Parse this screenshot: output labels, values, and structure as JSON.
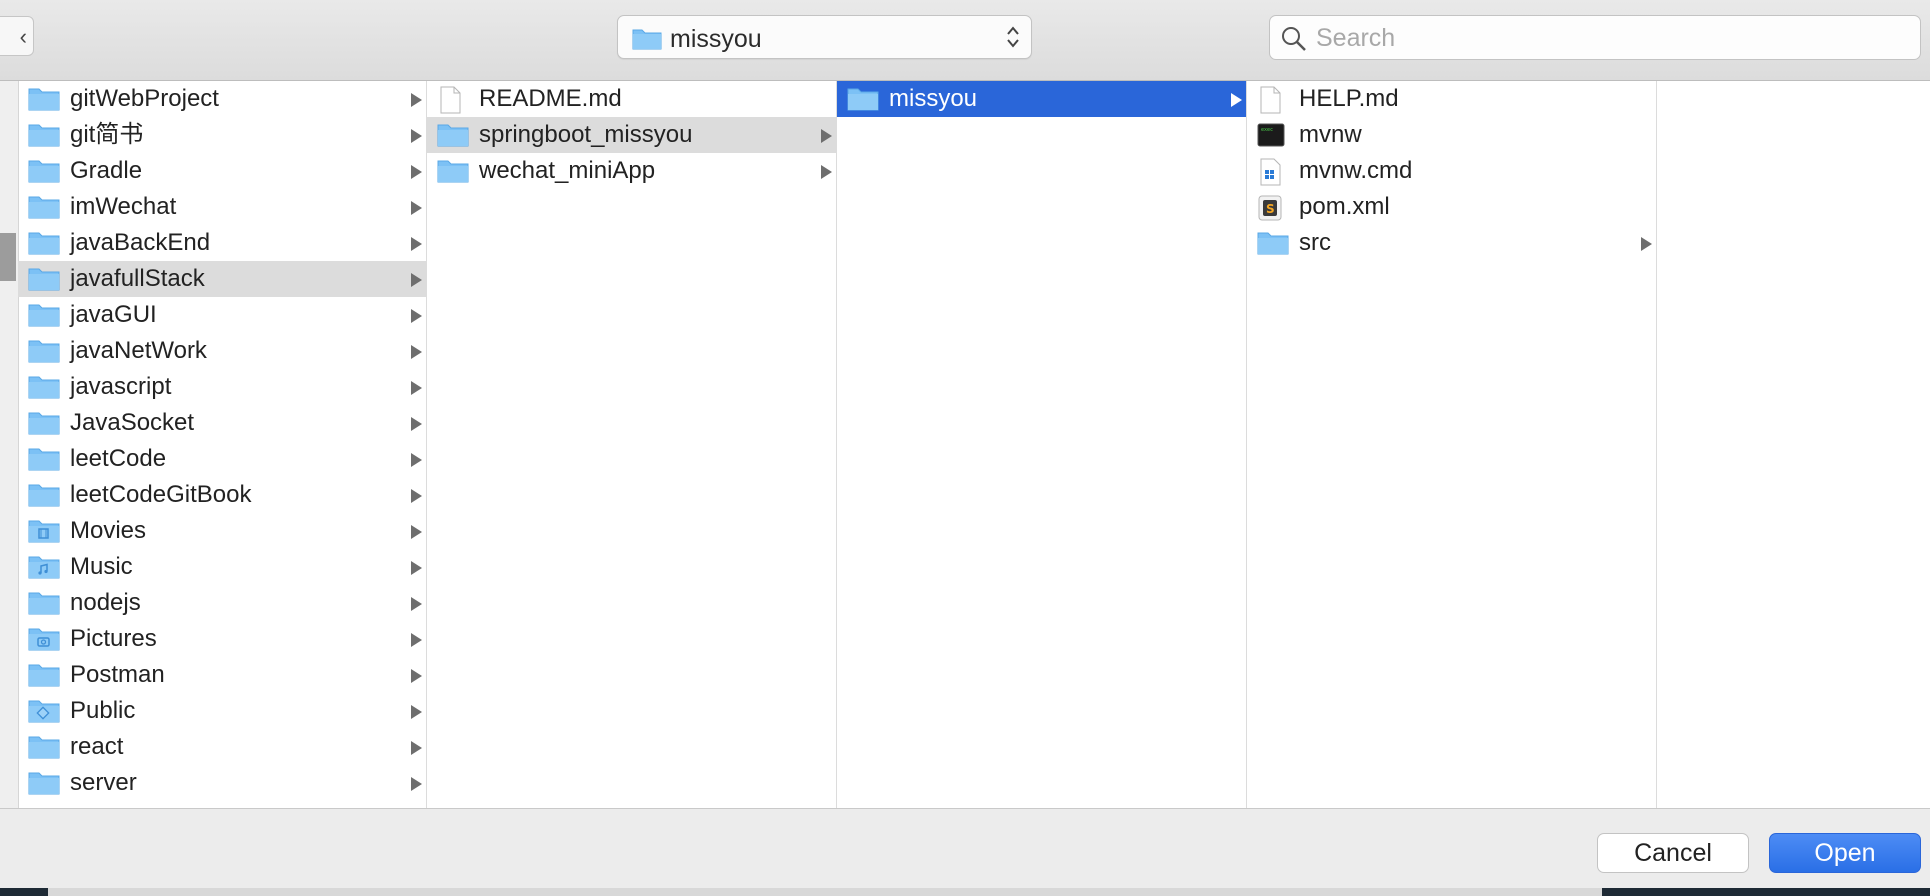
{
  "toolbar": {
    "back_glyph": "‹",
    "path_popup": {
      "label": "missyou"
    },
    "search": {
      "placeholder": "Search"
    }
  },
  "columns": [
    {
      "items": [
        {
          "name": "gitWebProject",
          "icon": "folder-icon",
          "has_children": true
        },
        {
          "name": "git简书",
          "icon": "folder-icon",
          "has_children": true
        },
        {
          "name": "Gradle",
          "icon": "folder-icon",
          "has_children": true
        },
        {
          "name": "imWechat",
          "icon": "folder-icon",
          "has_children": true
        },
        {
          "name": "javaBackEnd",
          "icon": "folder-icon",
          "has_children": true
        },
        {
          "name": "javafullStack",
          "icon": "folder-icon",
          "has_children": true,
          "selected": "gray"
        },
        {
          "name": "javaGUI",
          "icon": "folder-icon",
          "has_children": true
        },
        {
          "name": "javaNetWork",
          "icon": "folder-icon",
          "has_children": true
        },
        {
          "name": "javascript",
          "icon": "folder-icon",
          "has_children": true
        },
        {
          "name": "JavaSocket",
          "icon": "folder-icon",
          "has_children": true
        },
        {
          "name": "leetCode",
          "icon": "folder-icon",
          "has_children": true
        },
        {
          "name": "leetCodeGitBook",
          "icon": "folder-icon",
          "has_children": true
        },
        {
          "name": "Movies",
          "icon": "movies-folder-icon",
          "has_children": true
        },
        {
          "name": "Music",
          "icon": "music-folder-icon",
          "has_children": true
        },
        {
          "name": "nodejs",
          "icon": "folder-icon",
          "has_children": true
        },
        {
          "name": "Pictures",
          "icon": "pictures-folder-icon",
          "has_children": true
        },
        {
          "name": "Postman",
          "icon": "folder-icon",
          "has_children": true
        },
        {
          "name": "Public",
          "icon": "public-folder-icon",
          "has_children": true
        },
        {
          "name": "react",
          "icon": "folder-icon",
          "has_children": true
        },
        {
          "name": "server",
          "icon": "folder-icon",
          "has_children": true
        }
      ]
    },
    {
      "items": [
        {
          "name": "README.md",
          "icon": "document-icon",
          "has_children": false
        },
        {
          "name": "springboot_missyou",
          "icon": "folder-icon",
          "has_children": true,
          "selected": "gray"
        },
        {
          "name": "wechat_miniApp",
          "icon": "folder-icon",
          "has_children": true
        }
      ]
    },
    {
      "items": [
        {
          "name": "missyou",
          "icon": "folder-icon",
          "has_children": true,
          "selected": "blue"
        }
      ]
    },
    {
      "items": [
        {
          "name": "HELP.md",
          "icon": "document-icon",
          "has_children": false
        },
        {
          "name": "mvnw",
          "icon": "terminal-exec-icon",
          "has_children": false
        },
        {
          "name": "mvnw.cmd",
          "icon": "windows-cmd-icon",
          "has_children": false
        },
        {
          "name": "pom.xml",
          "icon": "xml-file-icon",
          "has_children": false
        },
        {
          "name": "src",
          "icon": "folder-icon",
          "has_children": true
        }
      ]
    },
    {
      "items": []
    }
  ],
  "footer": {
    "cancel_label": "Cancel",
    "open_label": "Open"
  },
  "colors": {
    "selection_blue": "#2a66d9",
    "selection_gray": "#dcdcdc",
    "folder_blue": "#6cb8f2"
  }
}
